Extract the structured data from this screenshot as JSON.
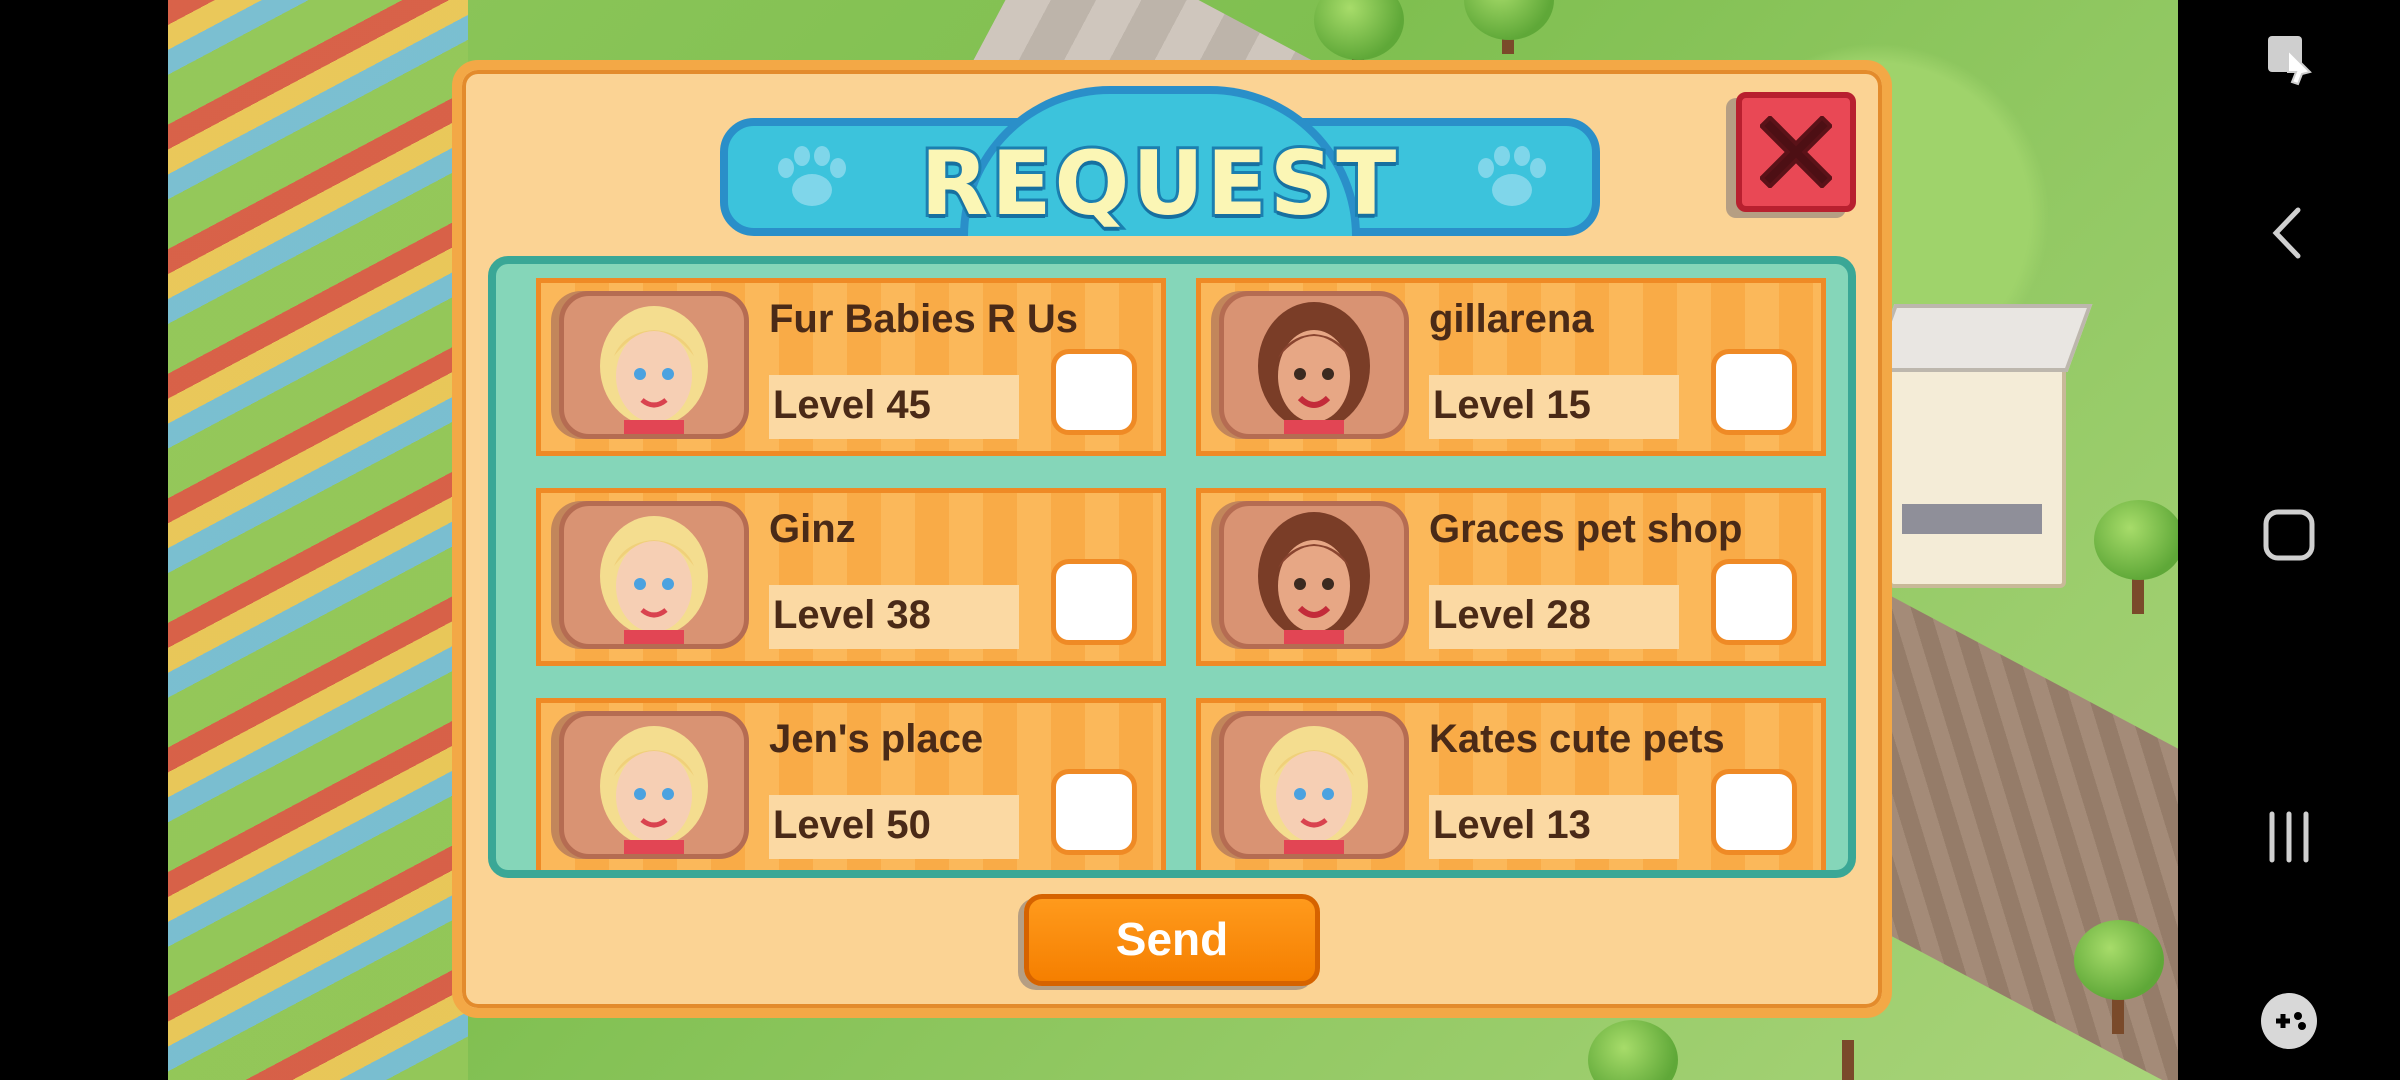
{
  "dialog": {
    "title": "REQUEST",
    "send_label": "Send"
  },
  "friends": [
    {
      "name": "Fur Babies R Us",
      "level": "Level 45",
      "avatar": "blonde",
      "checked": false
    },
    {
      "name": "gillarena",
      "level": "Level 15",
      "avatar": "brunette",
      "checked": false
    },
    {
      "name": "Ginz",
      "level": "Level 38",
      "avatar": "blonde",
      "checked": false
    },
    {
      "name": "Graces pet shop",
      "level": "Level 28",
      "avatar": "brunette",
      "checked": false
    },
    {
      "name": "Jen's place",
      "level": "Level 50",
      "avatar": "blonde",
      "checked": false
    },
    {
      "name": "Kates cute pets",
      "level": "Level 13",
      "avatar": "blonde",
      "checked": false
    }
  ],
  "nav": {
    "icons": [
      "screenshot-cursor-icon",
      "back-icon",
      "home-icon",
      "recents-icon",
      "game-tools-icon"
    ]
  },
  "colors": {
    "dialog_bg": "#fbd394",
    "dialog_border": "#f3a846",
    "panel_bg": "#85d6b9",
    "title_bg": "#3cc3dc",
    "close_red": "#e94855",
    "send_orange": "#f57f00"
  }
}
